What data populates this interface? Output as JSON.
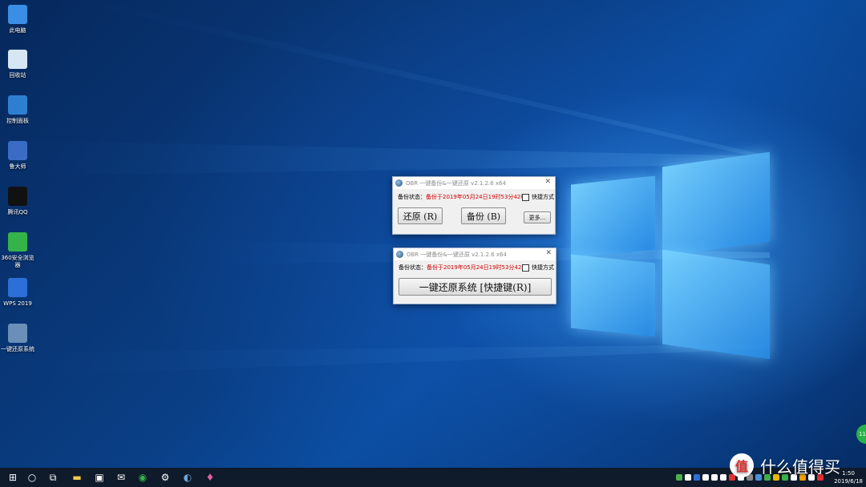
{
  "desktop_icons": [
    {
      "label": "此电脑",
      "icon": "computer-icon",
      "color": "#3a8ee6"
    },
    {
      "label": "回收站",
      "icon": "recycle-bin-icon",
      "color": "#d7e6f3"
    },
    {
      "label": "控制面板",
      "icon": "control-panel-icon",
      "color": "#2f7fd1"
    },
    {
      "label": "鲁大师",
      "icon": "ludashi-icon",
      "color": "#3b6cc4"
    },
    {
      "label": "腾讯QQ",
      "icon": "qq-icon",
      "color": "#111111"
    },
    {
      "label": "360安全浏览器",
      "icon": "browser-360-icon",
      "color": "#35b34a"
    },
    {
      "label": "WPS 2019",
      "icon": "wps-icon",
      "color": "#2d6fd8"
    },
    {
      "label": "一键还原系统",
      "icon": "onekey-restore-icon",
      "color": "#6a8fb8"
    }
  ],
  "dialog1": {
    "title": "OBR 一键备份&一键还原 v2.1.2.6 x64",
    "status_label": "备份状态：",
    "status_value": "备份于2019年05月24日19时53分42秒",
    "shortcut_label": "快捷方式",
    "restore_label": "还原 (R)",
    "backup_label": "备份 (B)",
    "more_label": "更多..."
  },
  "dialog2": {
    "title": "OBR 一键备份&一键还原 v2.1.2.6 x64",
    "status_label": "备份状态：",
    "status_value": "备份于2019年05月24日19时53分42秒",
    "shortcut_label": "快捷方式",
    "restore_system_label": "一键还原系统 [快捷键(R)]"
  },
  "taskbar": {
    "apps": [
      "start-icon",
      "search-icon",
      "task-view-icon",
      "file-explorer-icon",
      "store-icon",
      "mail-icon",
      "browser-360-icon",
      "settings-icon",
      "onekey-restore-icon",
      "paint-icon"
    ],
    "clock_time": "1:50",
    "clock_date": "2019/6/18"
  },
  "watermark": {
    "badge": "值",
    "text": "什么值得买"
  },
  "fab_text": "11"
}
